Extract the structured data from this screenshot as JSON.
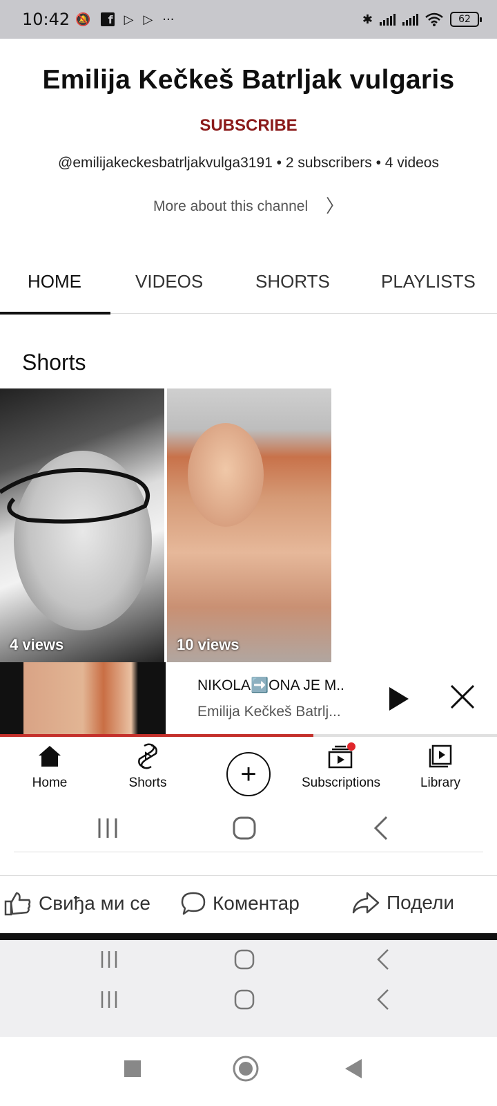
{
  "status_bar": {
    "time": "10:42",
    "battery": "62"
  },
  "channel": {
    "name": "Emilija Kečkeš Batrljak vulgaris",
    "subscribe_label": "SUBSCRIBE",
    "handle": "@emilijakeckesbatrljakvulga3191",
    "subscribers": "2 subscribers",
    "videos": "4 videos",
    "more_about": "More about this channel"
  },
  "tabs": [
    {
      "label": "HOME",
      "active": true
    },
    {
      "label": "VIDEOS",
      "active": false
    },
    {
      "label": "SHORTS",
      "active": false
    },
    {
      "label": "PLAYLISTS",
      "active": false
    }
  ],
  "section_title": "Shorts",
  "shorts": [
    {
      "views": "4 views"
    },
    {
      "views": "10 views"
    }
  ],
  "mini_player": {
    "title": "NIKOLA➡️ONA JE M..",
    "channel": "Emilija Kečkeš Batrlj...",
    "progress": 0.63
  },
  "bottom_nav": [
    {
      "label": "Home",
      "icon": "home-icon"
    },
    {
      "label": "Shorts",
      "icon": "shorts-icon"
    },
    {
      "label": "",
      "icon": "create-icon"
    },
    {
      "label": "Subscriptions",
      "icon": "subscriptions-icon"
    },
    {
      "label": "Library",
      "icon": "library-icon"
    }
  ],
  "facebook_actions": {
    "like": "Свиђа ми се",
    "comment": "Коментар",
    "share": "Подели"
  },
  "colors": {
    "subscribe": "#8b1a1a",
    "progress": "#c4302b",
    "notification_dot": "#e0262b"
  }
}
